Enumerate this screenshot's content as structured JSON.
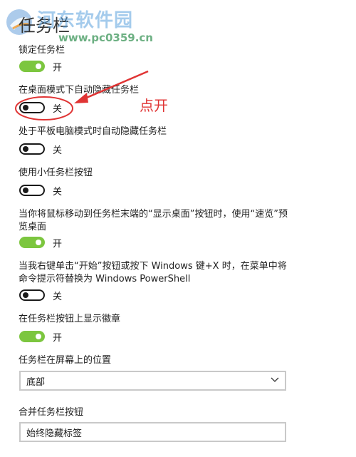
{
  "page_title": "任务栏",
  "watermark": {
    "title": "河东软件园",
    "url": "www.pc0359.cn"
  },
  "settings": [
    {
      "label": "锁定任务栏",
      "state": "开",
      "on": true
    },
    {
      "label": "在桌面模式下自动隐藏任务栏",
      "state": "关",
      "on": false
    },
    {
      "label": "处于平板电脑模式时自动隐藏任务栏",
      "state": "关",
      "on": false
    },
    {
      "label": "使用小任务栏按钮",
      "state": "关",
      "on": false
    },
    {
      "label": "当你将鼠标移动到任务栏末端的“显示桌面”按钮时，使用“速览”预览桌面",
      "state": "开",
      "on": true
    },
    {
      "label": "当我右键单击“开始”按钮或按下 Windows 键+X 时，在菜单中将命令提示符替换为 Windows PowerShell",
      "state": "关",
      "on": false
    },
    {
      "label": "在任务栏按钮上显示徽章",
      "state": "开",
      "on": true
    }
  ],
  "position": {
    "label": "任务栏在屏幕上的位置",
    "value": "底部"
  },
  "combine": {
    "label": "合并任务栏按钮",
    "value": "始终隐藏标签"
  },
  "annotation": {
    "text": "点开",
    "color": "#e03434"
  },
  "colors": {
    "toggle_on": "#7cc63f",
    "toggle_off_border": "#1a1a1a"
  }
}
